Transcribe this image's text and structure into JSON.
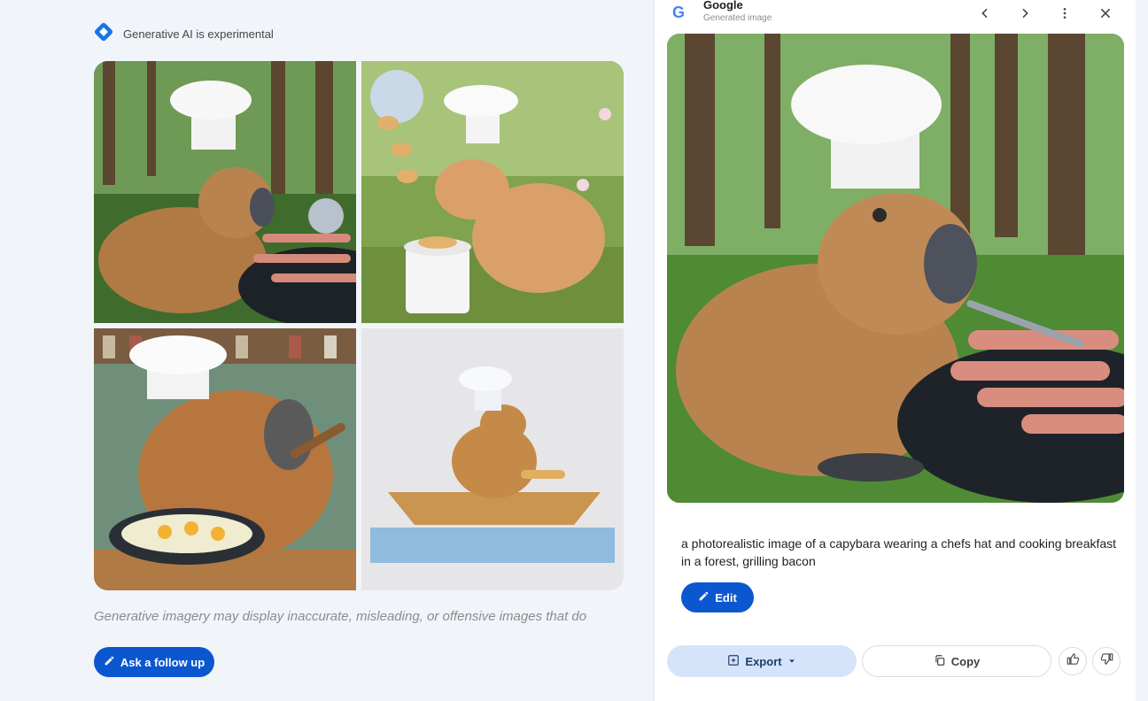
{
  "left": {
    "experimental_label": "Generative AI is experimental",
    "disclaimer": "Generative imagery may display inaccurate, misleading, or offensive images that do",
    "follow_up_label": "Ask a follow up"
  },
  "right": {
    "source_name": "Google",
    "source_sub": "Generated image",
    "prompt": "a photorealistic image of a capybara wearing a chefs hat and cooking breakfast in a forest, grilling bacon",
    "edit_label": "Edit",
    "export_label": "Export",
    "copy_label": "Copy"
  },
  "colors": {
    "primary": "#0b57d0",
    "tonal": "#d6e4fb",
    "background": "#f1f4f9"
  },
  "icons": [
    "sparkle-diamond-icon",
    "google-g-icon",
    "chevron-left-icon",
    "chevron-right-icon",
    "more-vert-icon",
    "close-icon",
    "pencil-icon",
    "export-icon",
    "caret-down-icon",
    "copy-icon",
    "thumb-up-icon",
    "thumb-down-icon"
  ]
}
